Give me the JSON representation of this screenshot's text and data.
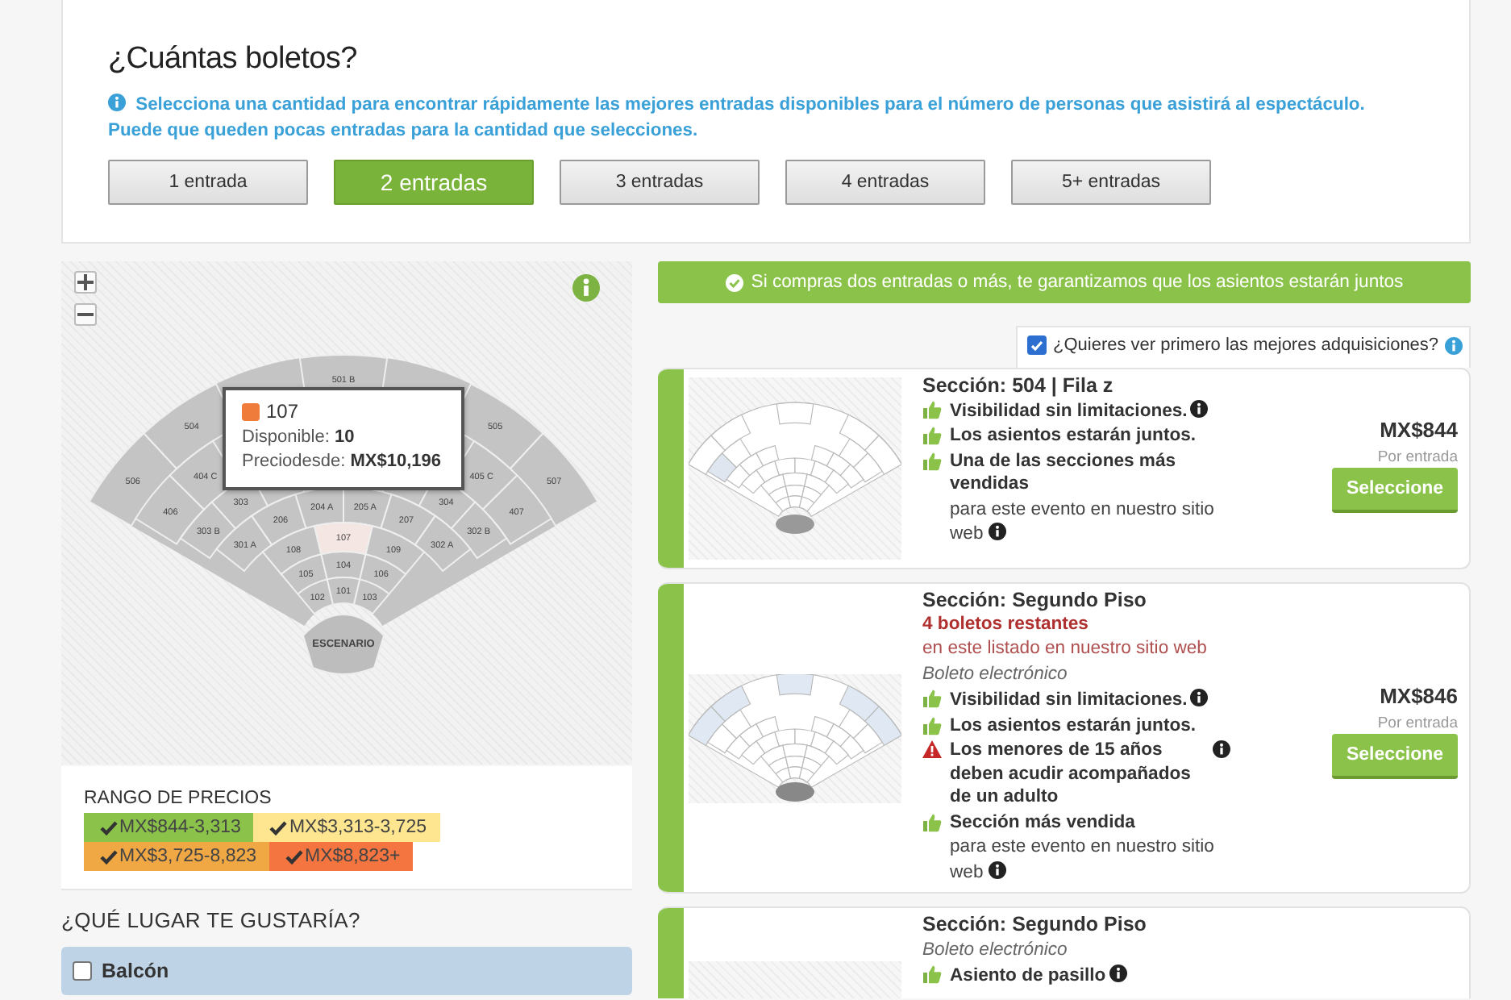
{
  "quantity": {
    "title": "¿Cuántas boletos?",
    "info": "Selecciona una cantidad para encontrar rápidamente las mejores entradas disponibles para el número de personas que asistirá al espectáculo. Puede que queden pocas entradas para la cantidad que selecciones.",
    "options": [
      {
        "label": "1 entrada",
        "selected": false
      },
      {
        "label": "2 entradas",
        "selected": true
      },
      {
        "label": "3 entradas",
        "selected": false
      },
      {
        "label": "4 entradas",
        "selected": false
      },
      {
        "label": "5+ entradas",
        "selected": false
      }
    ]
  },
  "seat_map": {
    "rings": [
      {
        "left": [
          {
            "label": "506",
            "highlighted": false
          },
          {
            "label": "504",
            "highlighted": false
          }
        ],
        "center": [
          {
            "label": "501 B",
            "highlighted": false
          }
        ],
        "right": [
          {
            "label": "505",
            "highlighted": false
          },
          {
            "label": "507",
            "highlighted": false
          }
        ]
      },
      {
        "left": [
          {
            "label": "406",
            "highlighted": false
          },
          {
            "label": "404 C",
            "highlighted": false
          }
        ],
        "right": [
          {
            "label": "405 C",
            "highlighted": false
          },
          {
            "label": "407",
            "highlighted": false
          }
        ]
      },
      {
        "left": [
          {
            "label": "303 B",
            "highlighted": false
          },
          {
            "label": "303",
            "highlighted": false
          },
          {
            "highlighted": false
          }
        ],
        "right": [
          {
            "highlighted": false
          },
          {
            "label": "304",
            "highlighted": false
          },
          {
            "label": "302 B",
            "highlighted": false
          }
        ]
      },
      [
        {
          "label": "301 A",
          "highlighted": false
        },
        {
          "label": "206",
          "highlighted": false
        },
        {
          "label": "204 A",
          "highlighted": false
        },
        {
          "label": "205 A",
          "highlighted": false
        },
        {
          "label": "207",
          "highlighted": false
        },
        {
          "label": "302 A",
          "highlighted": false
        }
      ],
      [
        {
          "label": "108",
          "highlighted": false
        },
        {
          "label": "107",
          "highlighted": true
        },
        {
          "label": "109",
          "highlighted": false
        }
      ],
      [
        {
          "label": "105",
          "highlighted": false
        },
        {
          "label": "104",
          "highlighted": false
        },
        {
          "label": "106",
          "highlighted": false
        }
      ],
      [
        {
          "label": "102",
          "highlighted": false
        },
        {
          "label": "101",
          "highlighted": false
        },
        {
          "label": "103",
          "highlighted": false
        }
      ]
    ],
    "stage": "ESCENARIO",
    "tooltip": {
      "color": "#f07c3c",
      "section": "107",
      "available": "Disponible: **10**",
      "price": "Preciodesde: **MX$10,196**"
    }
  },
  "price_ranges": {
    "title": "RANGO DE PRECIOS",
    "ranges": [
      {
        "label": "MX$844-3,313",
        "color": "#8bc34a"
      },
      {
        "label": "MX$3,313-3,725",
        "color": "#fde68f"
      },
      {
        "label": "MX$3,725-8,823",
        "color": "#f0a845"
      },
      {
        "label": "MX$8,823+",
        "color": "#f47540"
      }
    ]
  },
  "filters": {
    "title": "¿QUÉ LUGAR TE GUSTARÍA?",
    "options": [
      {
        "label": "Balcón",
        "checked": false
      }
    ]
  },
  "banner": "Si compras dos entradas o más, te garantizamos que los asientos estarán juntos",
  "best_first": {
    "label": "¿Quieres ver primero las mejores adquisiciones?",
    "checked": true
  },
  "listings": [
    {
      "section": "Sección: 504 | Fila z",
      "thumbnail": {
        "kind": "section"
      },
      "features": [
        {
          "kind": "thumb",
          "text": "Visibilidad sin limitaciones.",
          "info": true
        },
        {
          "kind": "thumb",
          "text": "Los asientos estarán juntos.",
          "info": false
        },
        {
          "kind": "thumb",
          "text": "Una de las secciones más vendidas",
          "info": false,
          "note": "para este evento en nuestro sitio web",
          "note_info": true
        }
      ],
      "price": "MX$844",
      "price_note": "Por entrada",
      "button": "Seleccione"
    },
    {
      "section": "Sección: Segundo Piso",
      "remaining": "4 boletos restantes",
      "remaining_note": "en este listado en nuestro sitio web",
      "delivery": "Boleto electrónico",
      "thumbnail": {
        "kind": "ring"
      },
      "features": [
        {
          "kind": "thumb",
          "text": "Visibilidad sin limitaciones.",
          "info": true
        },
        {
          "kind": "thumb",
          "text": "Los asientos estarán juntos.",
          "info": false
        },
        {
          "kind": "warning",
          "text": "Los menores de 15 años deben acudir acompañados de un adulto",
          "info": true
        },
        {
          "kind": "thumb",
          "text": "Sección más vendida",
          "info": false,
          "note": "para este evento en nuestro sitio web",
          "note_info": true
        }
      ],
      "price": "MX$846",
      "price_note": "Por entrada",
      "button": "Seleccione"
    },
    {
      "section": "Sección: Segundo Piso",
      "delivery": "Boleto electrónico",
      "features": [
        {
          "kind": "thumb",
          "text": "Asiento de pasillo",
          "info": true
        }
      ]
    }
  ]
}
